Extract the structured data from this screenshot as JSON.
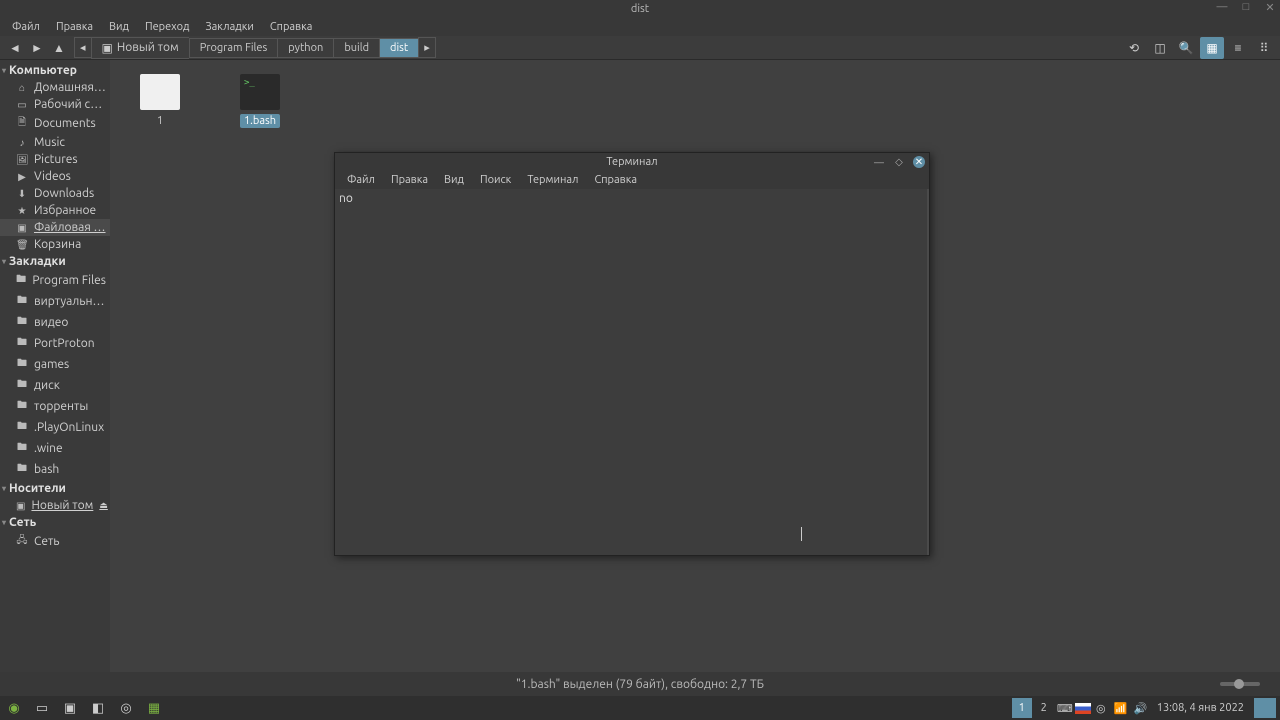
{
  "window": {
    "title": "dist"
  },
  "menu": {
    "items": [
      "Файл",
      "Правка",
      "Вид",
      "Переход",
      "Закладки",
      "Справка"
    ]
  },
  "breadcrumbs": [
    "Новый том",
    "Program Files",
    "python",
    "build",
    "dist"
  ],
  "toolbar_right_icons": [
    "restore",
    "new-tab",
    "search",
    "grid-view",
    "list-view",
    "compact-view"
  ],
  "sidebar": {
    "sections": [
      {
        "title": "Компьютер",
        "items": [
          {
            "icon": "home",
            "label": "Домашняя…"
          },
          {
            "icon": "desktop",
            "label": "Рабочий с…"
          },
          {
            "icon": "folder",
            "label": "Documents"
          },
          {
            "icon": "music",
            "label": "Music"
          },
          {
            "icon": "pictures",
            "label": "Pictures"
          },
          {
            "icon": "videos",
            "label": "Videos"
          },
          {
            "icon": "download",
            "label": "Downloads"
          },
          {
            "icon": "star",
            "label": "Избранное"
          },
          {
            "icon": "disk",
            "label": "Файловая …",
            "selected": true
          },
          {
            "icon": "trash",
            "label": "Корзина"
          }
        ]
      },
      {
        "title": "Закладки",
        "items": [
          {
            "icon": "folder",
            "label": "Program Files"
          },
          {
            "icon": "folder",
            "label": "виртуальн…"
          },
          {
            "icon": "folder",
            "label": "видео"
          },
          {
            "icon": "folder",
            "label": "PortProton"
          },
          {
            "icon": "folder",
            "label": "games"
          },
          {
            "icon": "folder",
            "label": "диск"
          },
          {
            "icon": "folder",
            "label": "торренты"
          },
          {
            "icon": "folder",
            "label": ".PlayOnLinux"
          },
          {
            "icon": "folder",
            "label": ".wine"
          },
          {
            "icon": "folder",
            "label": "bash"
          }
        ]
      },
      {
        "title": "Носители",
        "items": [
          {
            "icon": "disk",
            "label": "Новый том",
            "eject": true,
            "underline": true
          }
        ]
      },
      {
        "title": "Сеть",
        "items": [
          {
            "icon": "network",
            "label": "Сеть"
          }
        ]
      }
    ]
  },
  "files": [
    {
      "name": "1",
      "type": "text"
    },
    {
      "name": "1.bash",
      "type": "script",
      "selected": true
    }
  ],
  "status": "\"1.bash\" выделен (79 байт), свободно: 2,7 ТБ",
  "terminal": {
    "title": "Терминал",
    "menu": [
      "Файл",
      "Правка",
      "Вид",
      "Поиск",
      "Терминал",
      "Справка"
    ],
    "output": "no"
  },
  "taskbar": {
    "workspaces": [
      "1",
      "2"
    ],
    "clock": "13:08, 4 янв 2022",
    "active_ws": "1"
  }
}
